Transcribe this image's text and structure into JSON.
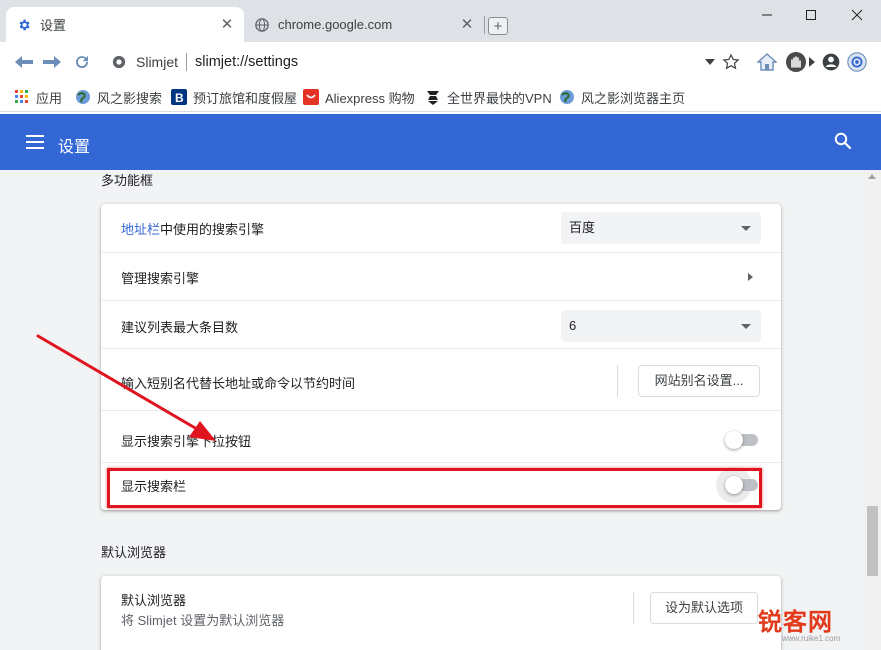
{
  "browser": {
    "tabs": [
      {
        "title": "设置",
        "icon": "gear-icon",
        "active": true
      },
      {
        "title": "chrome.google.com",
        "icon": "globe-icon",
        "active": false
      }
    ],
    "new_tab_label": "+",
    "omnibox": {
      "brand": "Slimjet",
      "url": "slimjet://settings"
    },
    "bookmarks": [
      {
        "label": "应用",
        "icon": "apps-grid-icon"
      },
      {
        "label": "风之影搜索",
        "icon": "globe-icon"
      },
      {
        "label": "预订旅馆和度假屋",
        "icon": "booking-icon"
      },
      {
        "label": "Aliexpress 购物",
        "icon": "aliexpress-icon"
      },
      {
        "label": "全世界最快的VPN",
        "icon": "vpn-icon"
      },
      {
        "label": "风之影浏览器主页",
        "icon": "globe-icon"
      }
    ]
  },
  "settings": {
    "header_title": "设置",
    "omnibox_section": {
      "title": "多功能框",
      "search_engine_link": "地址栏",
      "search_engine_label": "中使用的搜索引擎",
      "search_engine_value": "百度",
      "manage_engines": "管理搜索引擎",
      "suggest_limit_label": "建议列表最大条目数",
      "suggest_limit_value": "6",
      "alias_label": "输入短别名代替长地址或命令以节约时间",
      "alias_button": "网站别名设置...",
      "show_dropdown_label": "显示搜索引擎下拉按钮",
      "show_dropdown_on": false,
      "show_searchbar_label": "显示搜索栏",
      "show_searchbar_on": false
    },
    "default_browser_section": {
      "title": "默认浏览器",
      "label": "默认浏览器",
      "sub_label": "将 Slimjet 设置为默认浏览器",
      "button": "设为默认选项"
    }
  },
  "colors": {
    "accent": "#3367d6",
    "annotation": "#e0141e"
  },
  "watermark": {
    "text": "锐客网",
    "sub": "www.ruike1.com"
  }
}
